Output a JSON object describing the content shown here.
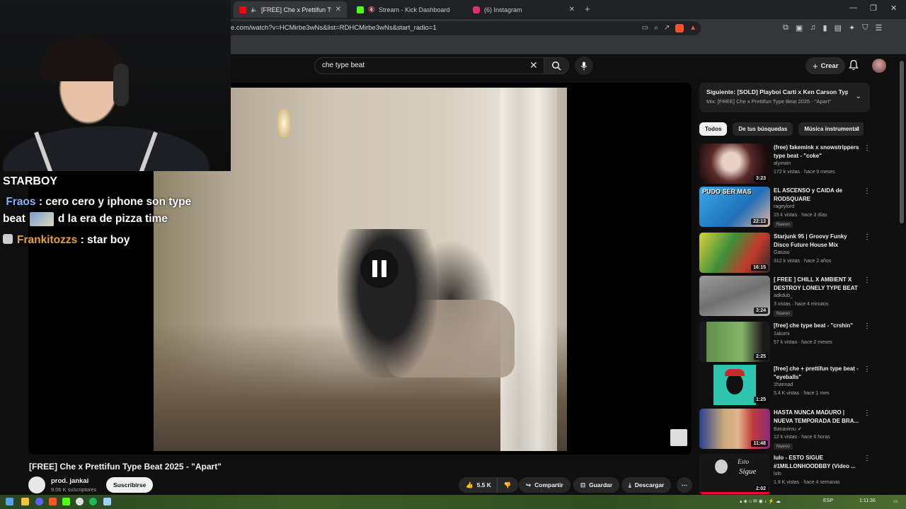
{
  "browser": {
    "tabs": [
      {
        "title": "[FREE] Che x Prettifun Type Be",
        "color": "#ff0000"
      },
      {
        "title": "Stream - Kick Dashboard",
        "color": "#53fc18"
      },
      {
        "title": "(6) Instagram",
        "color": "#e1306c"
      }
    ],
    "url": "e.com/watch?v=HCMirbe3wNs&list=RDHCMirbe3wNs&start_radio=1"
  },
  "youtube": {
    "search_value": "che type beat",
    "create_label": "Crear"
  },
  "stream_overlay": {
    "chat_title": "STARBOY",
    "messages": [
      {
        "user": "Fraos",
        "text_a": ": cero cero y iphone son type",
        "text_b": "beat",
        "text_c": "d la era de pizza time"
      },
      {
        "user": "Frankitozzs",
        "text": ": star boy"
      }
    ]
  },
  "video": {
    "title": "[FREE] Che x Prettifun Type Beat 2025 - \"Apart\"",
    "channel": "prod. jankai",
    "subscribers": "9.06 K suscriptores",
    "subscribe_label": "Suscribirse",
    "likes": "5.5 K",
    "share_label": "Compartir",
    "save_label": "Guardar",
    "download_label": "Descargar"
  },
  "sidebar": {
    "up_next_label": "Siguiente:",
    "up_next_title": "[SOLD] Playboi Carti x Ken Carson Type ...",
    "up_next_mix": "Mix: [FREE] Che x Prettifun Type Beat 2025 - \"Apart\"",
    "chips": [
      "Todos",
      "De tus búsquedas",
      "Música instrumental"
    ],
    "recommendations": [
      {
        "title": "(free) fakemink x snowstrippers type beat - \"coke\"",
        "channel": "alyxrain",
        "meta": "172 k vistas · hace 9 meses",
        "duration": "3:23",
        "badge": "",
        "thumb": "#3a1a1a"
      },
      {
        "title": "EL ASCENSO y CAIDA de RODSQUARE",
        "channel": "rageylord",
        "meta": "15 k vistas · hace 3 días",
        "duration": "22:13",
        "badge": "Nuevo",
        "thumb": "#2b8fd8"
      },
      {
        "title": "Starjunk 95 | Groovy Funky Disco Future House Mix",
        "channel": "Gatuso",
        "meta": "312 k vistas · hace 2 años",
        "duration": "16:15",
        "badge": "",
        "thumb": "#c9c23a"
      },
      {
        "title": "[ FREE ] CHILL X AMBIENT X DESTROY LONELY TYPE BEAT ...",
        "channel": "adkdub_",
        "meta": "3 vistas · hace 4 minutos",
        "duration": "3:24",
        "badge": "Nuevo",
        "thumb": "#8a8a8a"
      },
      {
        "title": "[free] che type beat - \"crshin\"",
        "channel": "1akumi",
        "meta": "57 k vistas · hace 2 meses",
        "duration": "2:25",
        "badge": "",
        "thumb": "#4d7a3a"
      },
      {
        "title": "[free] che + prettifun type beat - \"eyeballs\"",
        "channel": "1hannad",
        "meta": "5.4 K vistas · hace 1 mes",
        "duration": "1:25",
        "badge": "",
        "thumb": "#2fc4b0"
      },
      {
        "title": "HASTA NUNCA MADURO | NUEVA TEMPORADA DE BRA...",
        "channel": "Bananirou",
        "meta": "12 k vistas · hace 6 horas",
        "duration": "11:48",
        "badge": "Nuevo",
        "thumb": "#c23b3b"
      },
      {
        "title": "lulo - ESTO SIGUE #1MILLONHOODBBY (Video ...",
        "channel": "lulo",
        "meta": "1.9 K vistas · hace 4 semanas",
        "duration": "2:02",
        "badge": "",
        "thumb": "#1a1a1a",
        "thumb_text_a": "Esto",
        "thumb_text_b": "Sigue"
      }
    ],
    "rec1_overlay": "PUDO SER MAS"
  },
  "taskbar": {
    "lang": "ESP",
    "time": "1:11:36"
  }
}
